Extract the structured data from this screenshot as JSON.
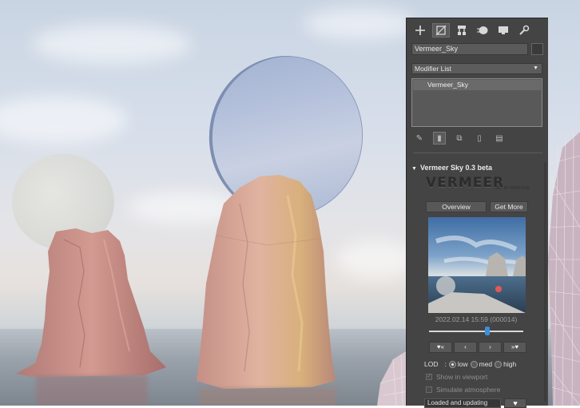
{
  "command_panel": {
    "tabs": [
      {
        "icon": "create-plus-icon"
      },
      {
        "icon": "modify-icon",
        "active": true
      },
      {
        "icon": "hierarchy-icon"
      },
      {
        "icon": "motion-icon"
      },
      {
        "icon": "display-icon"
      },
      {
        "icon": "utilities-wrench-icon"
      }
    ],
    "object_name": "Vermeer_Sky",
    "modifier_list_label": "Modifier List",
    "stack_items": [
      "Vermeer_Sky"
    ],
    "stack_tools": [
      "pin-stack-icon",
      "show-end-result-icon",
      "make-unique-icon",
      "remove-modifier-icon",
      "configure-sets-icon"
    ]
  },
  "rollout": {
    "title": "Vermeer Sky 0.3 beta",
    "logo_text": "VERMEER",
    "logo_subtext": "SKY BY PROFUSE",
    "overview_label": "Overview",
    "get_more_label": "Get More",
    "preview_caption": "2022.02.14 15:59 (000014)",
    "time_slider_value": 0.62,
    "nav_buttons": [
      "♥«",
      "‹",
      "›",
      "»♥"
    ],
    "lod_label": "LOD",
    "lod_options": [
      {
        "label": "low",
        "selected": true
      },
      {
        "label": "med",
        "selected": false
      },
      {
        "label": "high",
        "selected": false
      }
    ],
    "show_in_viewport_label": "Show in viewport",
    "show_in_viewport_checked": true,
    "simulate_atmosphere_label": "Simulate atmosphere",
    "simulate_atmosphere_checked": false,
    "status_label": "Loaded and updating",
    "heart_label": "♥"
  },
  "colors": {
    "panel_bg": "#444444",
    "slider_accent": "#3d8fd8",
    "rock": "#c98f86",
    "sky": "#cfd8e6"
  }
}
